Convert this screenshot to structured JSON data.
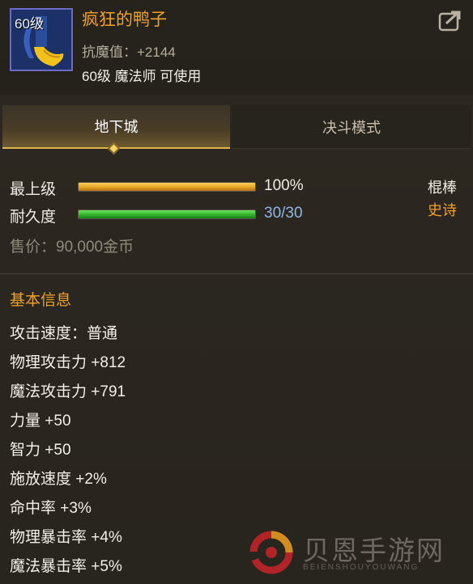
{
  "item": {
    "level_badge": "60级",
    "name": "疯狂的鸭子",
    "stat_line": "抗魔值：+2144",
    "requirement": "60级 魔法师 可使用",
    "icon": "duck-weapon-icon"
  },
  "header": {
    "share_icon": "share-icon"
  },
  "tabs": [
    {
      "label": "地下城",
      "active": true
    },
    {
      "label": "决斗模式",
      "active": false
    }
  ],
  "bars": {
    "max_level": {
      "label": "最上级",
      "value_text": "100%",
      "fill_percent": 100
    },
    "durability": {
      "label": "耐久度",
      "value_text": "30/30",
      "fill_percent": 100
    }
  },
  "weapon_type": "棍棒",
  "rarity": "史诗",
  "price": "售价：90,000金币",
  "basic_info": {
    "title": "基本信息",
    "attributes": [
      "攻击速度：普通",
      "物理攻击力 +812",
      "魔法攻击力 +791",
      "力量 +50",
      "智力 +50",
      "施放速度 +2%",
      "命中率 +3%",
      "物理暴击率 +4%",
      "魔法暴击率 +5%"
    ]
  },
  "watermark": {
    "title": "贝恩手游网",
    "subtitle": "BEIENSHOUYOUWANG"
  },
  "colors": {
    "item_name": "#f0a12a",
    "rarity": "#f0a12a",
    "section_title": "#f0a12a",
    "bar_gold": "#e8a323",
    "bar_green": "#31b32a",
    "tab_accent": "#e0b44a"
  }
}
